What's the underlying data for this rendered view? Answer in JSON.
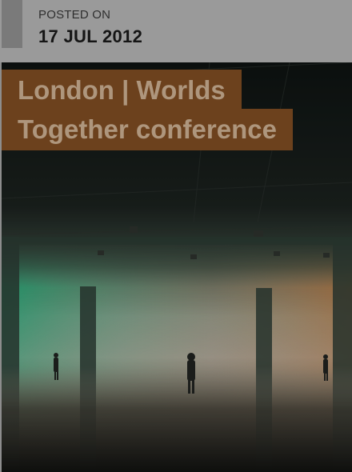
{
  "post": {
    "posted_label": "POSTED ON",
    "date": "17 JUL 2012"
  },
  "article": {
    "title_line_1": "London | Worlds",
    "title_line_2": "Together conference"
  },
  "colors": {
    "title_background": "#7c4a22",
    "title_text": "#c6ab8f",
    "header_background": "#9a9a9a",
    "accent_bar": "#7a7a7a"
  }
}
